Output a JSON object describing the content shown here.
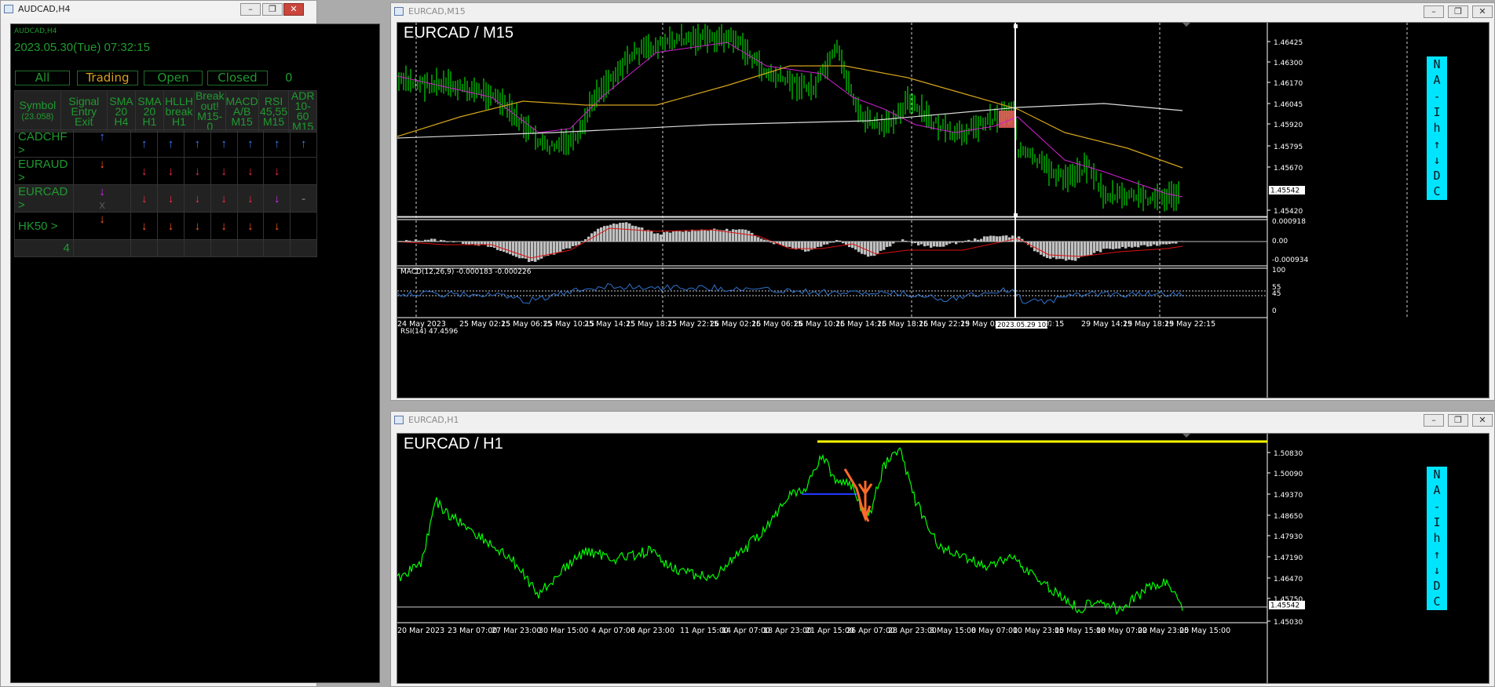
{
  "left_window": {
    "title": "AUDCAD,H4",
    "subtitle": "AUDCAD,H4",
    "datetime": "2023.05.30(Tue) 07:32:15",
    "filter_tabs": [
      "All",
      "Trading",
      "Open",
      "Closed"
    ],
    "trade_count": "0",
    "headers": {
      "symbol": [
        "Symbol",
        "(23.058)"
      ],
      "signal": [
        "Signal",
        "Entry Exit"
      ],
      "sma_h4": [
        "SMA",
        "20",
        "H4"
      ],
      "sma_h1": [
        "SMA",
        "20",
        "H1"
      ],
      "hllh": [
        "HLLH",
        "break",
        "H1"
      ],
      "breakout": [
        "Break",
        "out!",
        "M15-0"
      ],
      "macd": [
        "MACD",
        "A/B",
        "M15"
      ],
      "rsi": [
        "RSI",
        "45,55",
        "M15"
      ],
      "adr": [
        "ADR",
        "10-60",
        "M15"
      ]
    },
    "rows": [
      {
        "symbol": "CADCHF",
        "entry": "↑",
        "exit": "",
        "sma_h4": "↑",
        "sma_h1": "↑",
        "hllh": "↑",
        "breakout": "↑",
        "macd": "↑",
        "rsi": "↑",
        "adr": "↑",
        "entry_color": "#3d7dff",
        "row_color": "#3d7dff",
        "adr_color": "#3d7dff"
      },
      {
        "symbol": "EURAUD",
        "entry": "↓",
        "exit": "",
        "sma_h4": "↓",
        "sma_h1": "↓",
        "hllh": "↓",
        "breakout": "↓",
        "macd": "↓",
        "rsi": "↓",
        "adr": "",
        "entry_color": "#ff5a1f",
        "row_color": "#ff2b4a",
        "adr_color": "#ff2b4a"
      },
      {
        "symbol": "EURCAD",
        "entry": "↓",
        "exit": "x",
        "sma_h4": "↓",
        "sma_h1": "↓",
        "hllh": "↓",
        "breakout": "↓",
        "macd": "↓",
        "rsi": "↓",
        "adr": "-",
        "entry_color": "#d62bff",
        "row_color": "#ff2b4a",
        "adr_color": "#666666"
      },
      {
        "symbol": "HK50",
        "entry": "↓",
        "exit": "",
        "sma_h4": "↓",
        "sma_h1": "↓",
        "hllh": "↓",
        "breakout": "↓",
        "macd": "↓",
        "rsi": "↓",
        "adr": "",
        "entry_color": "#ff5a1f",
        "row_color": "#ff5a1f",
        "adr_color": "#ff5a1f"
      }
    ],
    "total": "4"
  },
  "m15_window": {
    "title": "EURCAD,M15",
    "chart_label": "EURCAD / M15",
    "price_ticks": [
      "1.46425",
      "1.46300",
      "1.46170",
      "1.46045",
      "1.45920",
      "1.45795",
      "1.45670",
      "1.45542",
      "1.45420"
    ],
    "current_price": "1.45542",
    "macd_label": "MACD(12,26,9) -0.000183 -0.000226",
    "macd_ticks": [
      "0.000918",
      "0.00",
      "-0.000934"
    ],
    "rsi_label": "RSI(14) 47.4596",
    "rsi_ticks": [
      "100",
      "55",
      "45",
      "0"
    ],
    "time_ticks": [
      "24 May 2023",
      "25 May 02:15",
      "25 May 06:15",
      "25 May 10:15",
      "25 May 14:15",
      "25 May 18:15",
      "25 May 22:15",
      "26 May 02:15",
      "26 May 06:15",
      "26 May 10:15",
      "26 May 14:15",
      "26 May 18:15",
      "26 May 22:15",
      "29 May 02:15",
      "29 M",
      "0:15",
      "29 May 14:15",
      "29 May 18:15",
      "29 May 22:15"
    ],
    "crosshair_time": "2023.05.29 10:00",
    "side_buttons": [
      "N",
      "A",
      "-",
      "I",
      "h",
      "↑",
      "↓",
      "D",
      "C"
    ]
  },
  "h1_window": {
    "title": "EURCAD,H1",
    "chart_label": "EURCAD / H1",
    "price_ticks": [
      "1.50830",
      "1.50090",
      "1.49370",
      "1.48650",
      "1.47930",
      "1.47190",
      "1.46470",
      "1.45750",
      "1.45542",
      "1.45030"
    ],
    "current_price": "1.45542",
    "time_ticks": [
      "20 Mar 2023",
      "23 Mar 07:00",
      "27 Mar 23:00",
      "30 Mar 15:00",
      "4 Apr 07:00",
      "6 Apr 23:00",
      "11 Apr 15:00",
      "14 Apr 07:00",
      "18 Apr 23:00",
      "21 Apr 15:00",
      "26 Apr 07:00",
      "28 Apr 23:00",
      "3 May 15:00",
      "8 May 07:00",
      "10 May 23:00",
      "15 May 15:00",
      "18 May 07:00",
      "22 May 23:00",
      "25 May 15:00"
    ],
    "side_buttons": [
      "N",
      "A",
      "-",
      "I",
      "h",
      "↑",
      "↓",
      "D",
      "C"
    ]
  },
  "colors": {
    "candles": "#00ff00",
    "sma_fast": "#d020d0",
    "sma_slow": "#d4a41c",
    "sma_long": "#dcdcdc",
    "macd_hist": "#c0c0c0",
    "macd_signal": "#e01010",
    "rsi": "#2f74d0",
    "button": "#00e5ff",
    "resistance": "#ffff00"
  }
}
